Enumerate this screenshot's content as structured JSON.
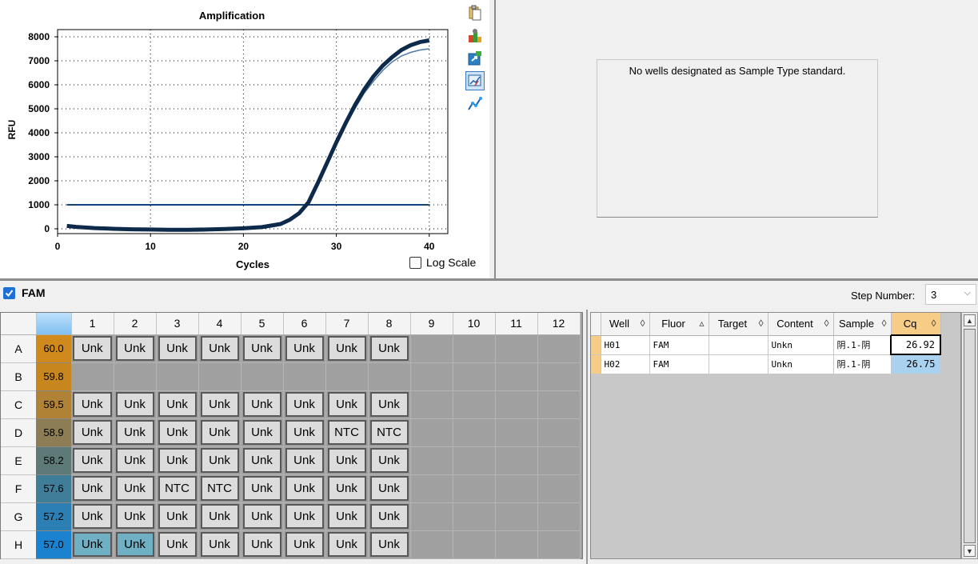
{
  "chart_title": "Amplification",
  "chart_data": {
    "type": "line",
    "title": "Amplification",
    "xlabel": "Cycles",
    "ylabel": "RFU",
    "xlim": [
      0,
      42
    ],
    "ylim": [
      -200,
      8300
    ],
    "xticks": [
      0,
      10,
      20,
      30,
      40
    ],
    "yticks": [
      0,
      1000,
      2000,
      3000,
      4000,
      5000,
      6000,
      7000,
      8000
    ],
    "grid": "dotted",
    "threshold": 1000,
    "series": [
      {
        "x": [
          1,
          2,
          4,
          6,
          8,
          10,
          12,
          14,
          16,
          18,
          20,
          22,
          24,
          25,
          26,
          27,
          28,
          29,
          30,
          31,
          32,
          33,
          34,
          35,
          36,
          37,
          38,
          39,
          40
        ],
        "values": [
          120,
          80,
          30,
          0,
          -20,
          -30,
          -40,
          -40,
          -30,
          -10,
          20,
          70,
          200,
          380,
          650,
          1100,
          1900,
          2750,
          3600,
          4400,
          5150,
          5800,
          6350,
          6800,
          7150,
          7450,
          7650,
          7780,
          7850
        ]
      },
      {
        "x": [
          1,
          2,
          4,
          6,
          8,
          10,
          12,
          14,
          16,
          18,
          20,
          22,
          24,
          25,
          26,
          27,
          28,
          29,
          30,
          31,
          32,
          33,
          34,
          35,
          36,
          37,
          38,
          39,
          40
        ],
        "values": [
          60,
          40,
          10,
          -10,
          -30,
          -40,
          -40,
          -40,
          -30,
          -10,
          10,
          60,
          180,
          350,
          600,
          1050,
          1850,
          2650,
          3500,
          4300,
          5000,
          5650,
          6150,
          6600,
          6950,
          7200,
          7350,
          7450,
          7500
        ]
      }
    ]
  },
  "log_scale_label": "Log Scale",
  "standard_message": "No wells designated as Sample Type standard.",
  "fluor_label": "FAM",
  "step_label": "Step Number:",
  "step_value": "3",
  "plate": {
    "columns": [
      "1",
      "2",
      "3",
      "4",
      "5",
      "6",
      "7",
      "8",
      "9",
      "10",
      "11",
      "12"
    ],
    "rows": [
      {
        "label": "A",
        "temp": "60.0",
        "temp_color": "#d08a1c",
        "wells": [
          "Unk",
          "Unk",
          "Unk",
          "Unk",
          "Unk",
          "Unk",
          "Unk",
          "Unk"
        ],
        "selected": []
      },
      {
        "label": "B",
        "temp": "59.8",
        "temp_color": "#c8861f",
        "wells": [],
        "selected": []
      },
      {
        "label": "C",
        "temp": "59.5",
        "temp_color": "#b08236",
        "wells": [
          "Unk",
          "Unk",
          "Unk",
          "Unk",
          "Unk",
          "Unk",
          "Unk",
          "Unk"
        ],
        "selected": []
      },
      {
        "label": "D",
        "temp": "58.9",
        "temp_color": "#8c7d55",
        "wells": [
          "Unk",
          "Unk",
          "Unk",
          "Unk",
          "Unk",
          "Unk",
          "NTC",
          "NTC"
        ],
        "selected": []
      },
      {
        "label": "E",
        "temp": "58.2",
        "temp_color": "#5e7a78",
        "wells": [
          "Unk",
          "Unk",
          "Unk",
          "Unk",
          "Unk",
          "Unk",
          "Unk",
          "Unk"
        ],
        "selected": []
      },
      {
        "label": "F",
        "temp": "57.6",
        "temp_color": "#3f7d99",
        "wells": [
          "Unk",
          "Unk",
          "NTC",
          "NTC",
          "Unk",
          "Unk",
          "Unk",
          "Unk"
        ],
        "selected": []
      },
      {
        "label": "G",
        "temp": "57.2",
        "temp_color": "#2c7fb3",
        "wells": [
          "Unk",
          "Unk",
          "Unk",
          "Unk",
          "Unk",
          "Unk",
          "Unk",
          "Unk"
        ],
        "selected": []
      },
      {
        "label": "H",
        "temp": "57.0",
        "temp_color": "#1b82cf",
        "wells": [
          "Unk",
          "Unk",
          "Unk",
          "Unk",
          "Unk",
          "Unk",
          "Unk",
          "Unk"
        ],
        "selected": [
          0,
          1
        ]
      }
    ]
  },
  "results": {
    "headers": [
      "Well",
      "Fluor",
      "Target",
      "Content",
      "Sample",
      "Cq"
    ],
    "sort_marks": [
      "◊",
      "▵",
      "◊",
      "◊",
      "◊",
      "◊"
    ],
    "rows": [
      {
        "well": "H01",
        "fluor": "FAM",
        "target": "",
        "content": "Unkn",
        "sample": "阴.1-阴",
        "cq": "26.92"
      },
      {
        "well": "H02",
        "fluor": "FAM",
        "target": "",
        "content": "Unkn",
        "sample": "阴.1-阴",
        "cq": "26.75"
      }
    ]
  },
  "colors": {
    "curve": "#0e2a4a",
    "curve_light": "#4d78a8",
    "threshold": "#12447a",
    "cq_header": "#f7cc86",
    "selected_well": "#6fb0c4"
  }
}
